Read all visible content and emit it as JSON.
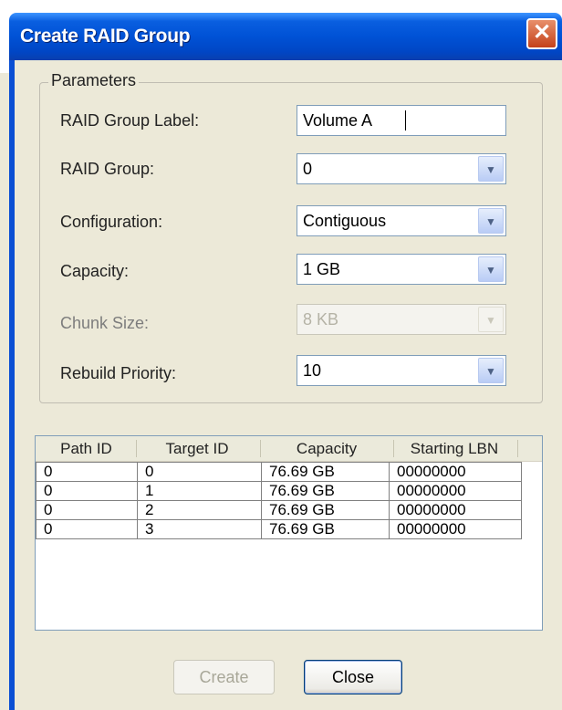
{
  "window": {
    "title": "Create RAID Group",
    "close_glyph": "✕",
    "accent": "#0052d6"
  },
  "parameters": {
    "legend": "Parameters",
    "raid_group_label": {
      "label": "RAID Group Label:",
      "value": "Volume A"
    },
    "raid_group": {
      "label": "RAID Group:",
      "value": "0"
    },
    "configuration": {
      "label": "Configuration:",
      "value": "Contiguous"
    },
    "capacity": {
      "label": "Capacity:",
      "value": "1 GB"
    },
    "chunk_size": {
      "label": "Chunk Size:",
      "value": "8 KB",
      "disabled": true
    },
    "rebuild_priority": {
      "label": "Rebuild Priority:",
      "value": "10"
    },
    "dropdown_icon": "chevron-down-icon"
  },
  "table": {
    "headers": [
      "Path ID",
      "Target ID",
      "Capacity",
      "Starting LBN"
    ],
    "rows": [
      [
        "0",
        "0",
        "76.69 GB",
        "00000000"
      ],
      [
        "0",
        "1",
        "76.69 GB",
        "00000000"
      ],
      [
        "0",
        "2",
        "76.69 GB",
        "00000000"
      ],
      [
        "0",
        "3",
        "76.69 GB",
        "00000000"
      ]
    ]
  },
  "buttons": {
    "create": {
      "label": "Create",
      "disabled": true
    },
    "close": {
      "label": "Close"
    }
  }
}
